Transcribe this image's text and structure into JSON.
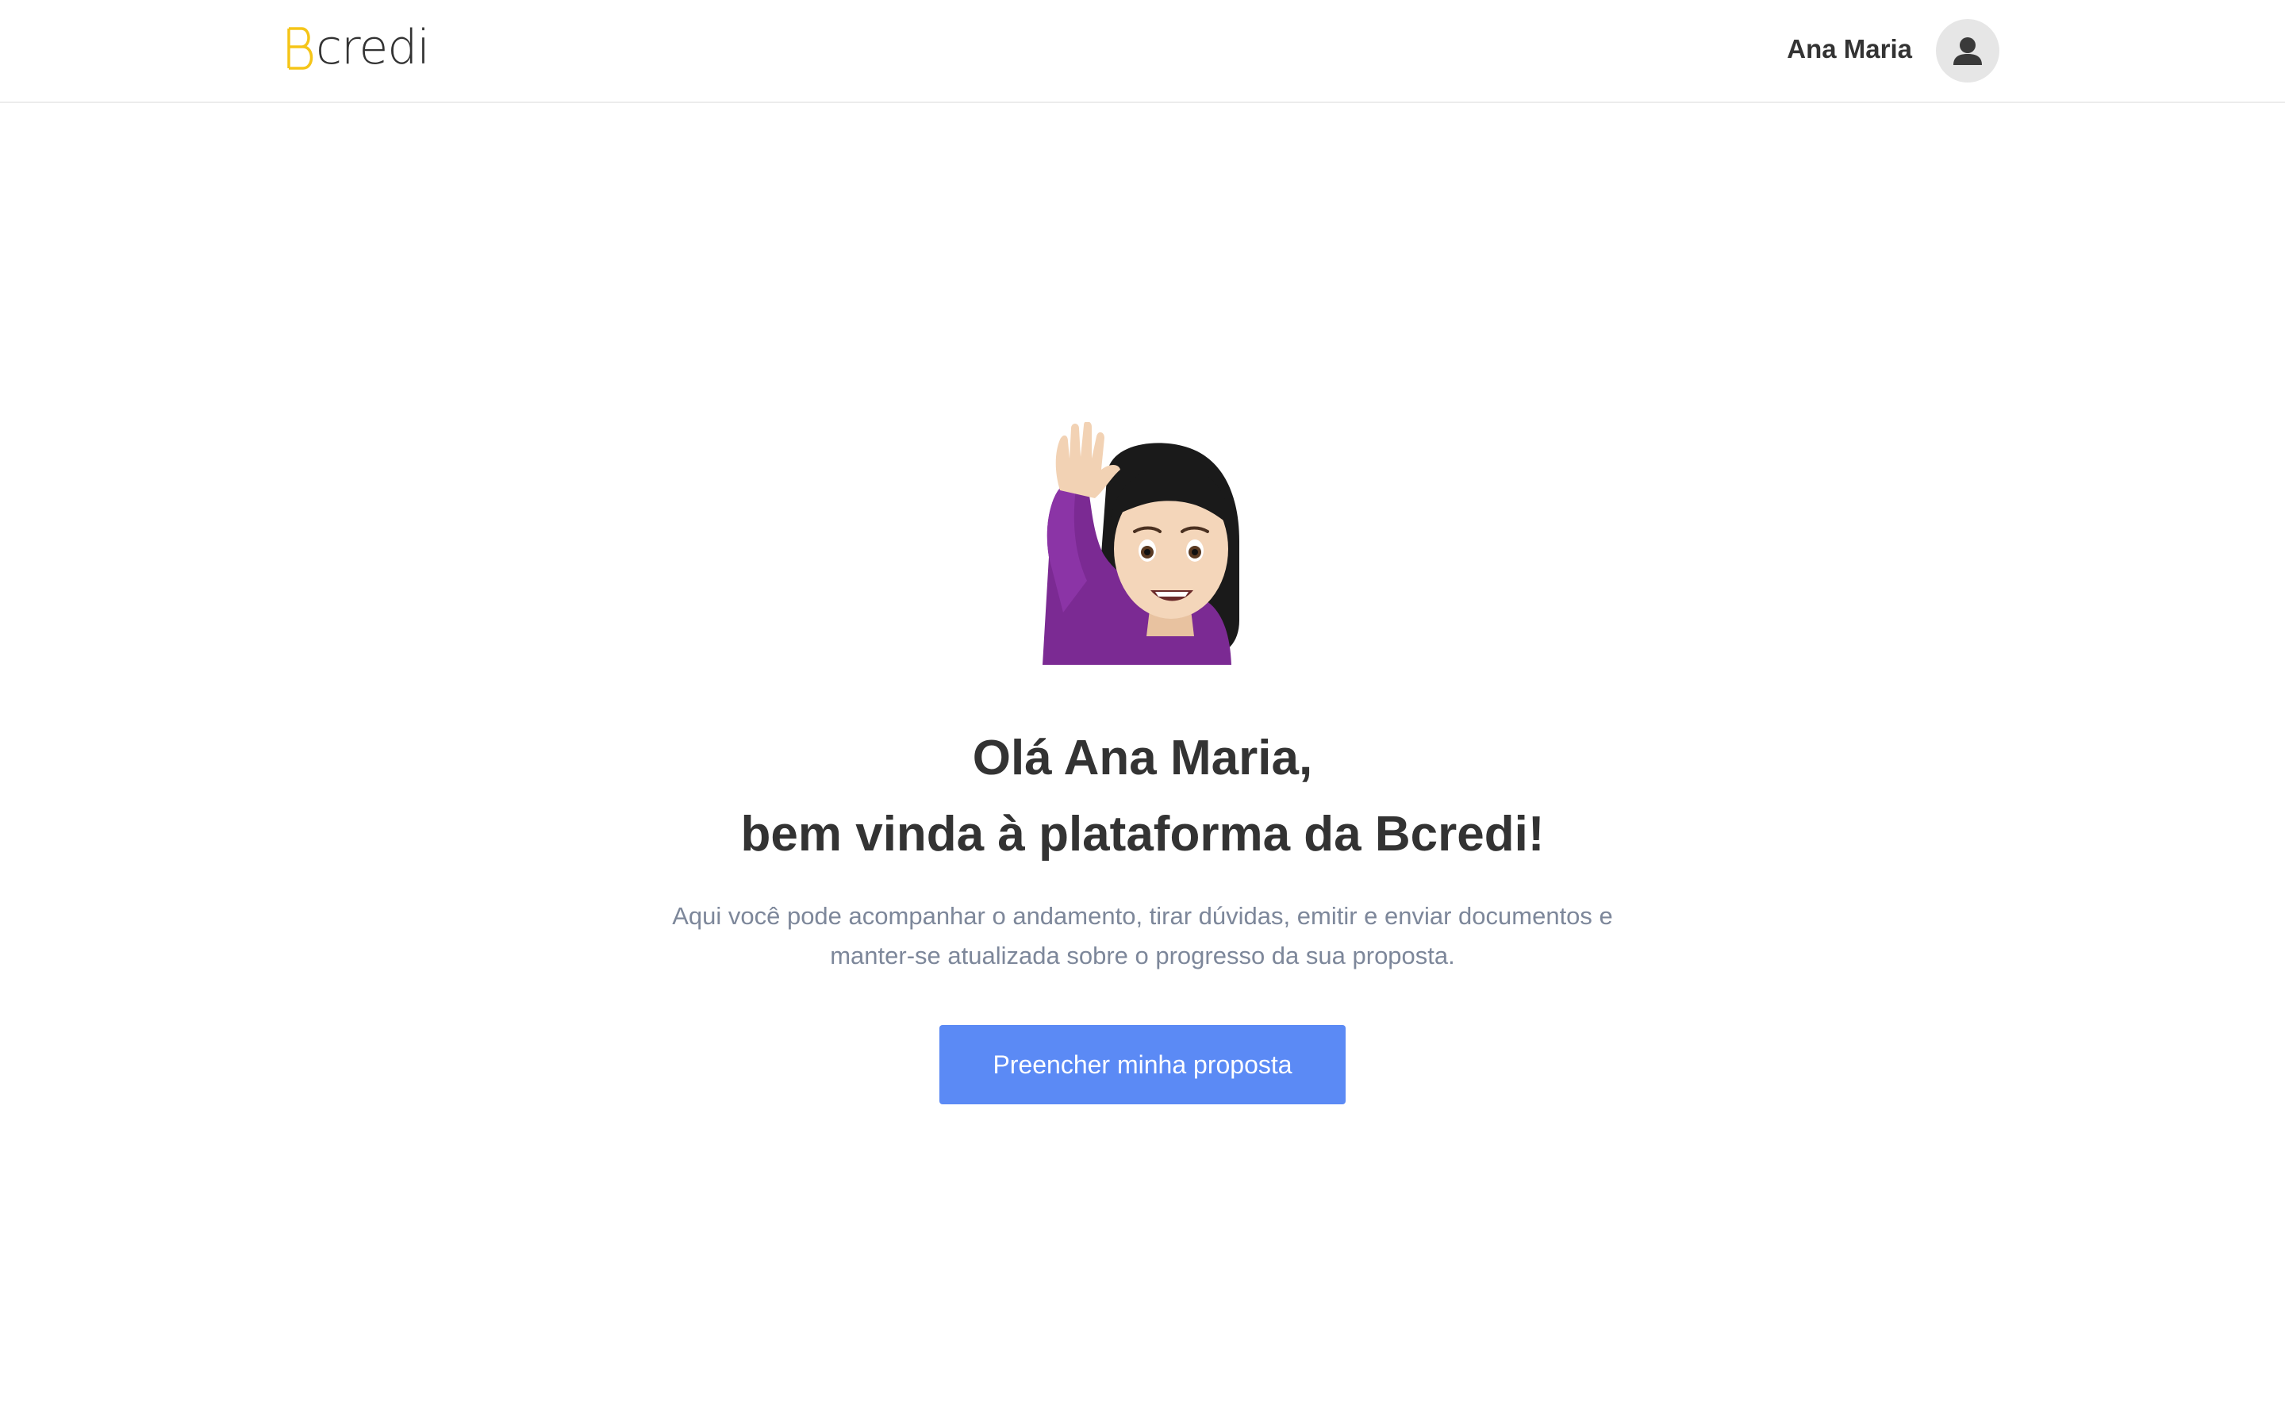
{
  "brand": {
    "logo_text": "credi",
    "logo_letter": "B",
    "accent_color": "#f5c518"
  },
  "header": {
    "user_name": "Ana Maria",
    "avatar_icon": "user-icon"
  },
  "hero": {
    "emoji": "person-raising-hand-icon"
  },
  "welcome": {
    "line1": "Olá Ana Maria,",
    "line2": "bem vinda à plataforma da Bcredi!",
    "description": "Aqui você pode acompanhar o andamento, tirar dúvidas, emitir e enviar documentos e manter-se atualizada sobre o progresso da sua proposta."
  },
  "cta": {
    "label": "Preencher minha proposta",
    "color": "#5b8af5"
  }
}
